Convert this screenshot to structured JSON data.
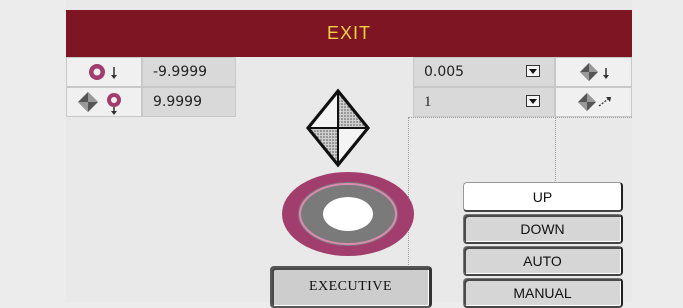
{
  "header": {
    "exit_label": "EXIT"
  },
  "left_fields": [
    {
      "icon": "ring-down-icon",
      "value": "-9.9999"
    },
    {
      "icon": "diamond-ring-down-icon",
      "value": "9.9999"
    }
  ],
  "right_fields": [
    {
      "value": "0.005",
      "icon": "diamond-down-icon"
    },
    {
      "value": "1",
      "icon": "diamond-diagonal-icon"
    }
  ],
  "controls": {
    "up": "UP",
    "down": "DOWN",
    "auto": "AUTO",
    "manual": "MANUAL",
    "executive": "EXECUTIVE"
  },
  "colors": {
    "header_bg": "#7e1522",
    "header_text": "#f3cf46",
    "ring_outer": "#a23e6e",
    "ring_inner": "#7a7a7a"
  }
}
